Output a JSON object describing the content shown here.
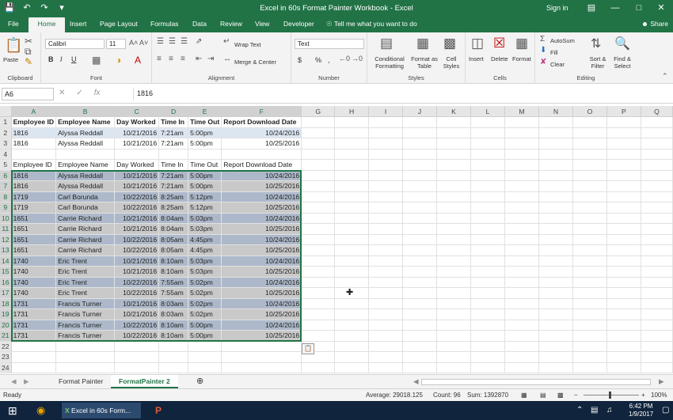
{
  "window": {
    "title": "Excel in 60s Format Painter Workbook  -  Excel",
    "signin": "Sign in"
  },
  "tabs": [
    "File",
    "Home",
    "Insert",
    "Page Layout",
    "Formulas",
    "Data",
    "Review",
    "View",
    "Developer"
  ],
  "tell_me": "Tell me what you want to do",
  "share": "Share",
  "ribbon": {
    "clipboard": {
      "paste": "Paste",
      "label": "Clipboard"
    },
    "font": {
      "name": "Calibri",
      "size": "11",
      "label": "Font",
      "bold": "B",
      "italic": "I",
      "underline": "U"
    },
    "alignment": {
      "wrap": "Wrap Text",
      "merge": "Merge & Center",
      "label": "Alignment"
    },
    "number": {
      "format": "Text",
      "label": "Number",
      "currency": "$",
      "percent": "%",
      "comma": ","
    },
    "styles": {
      "cond": "Conditional Formatting",
      "table": "Format as Table",
      "cell": "Cell Styles",
      "label": "Styles"
    },
    "cells": {
      "insert": "Insert",
      "delete": "Delete",
      "format": "Format",
      "label": "Cells"
    },
    "editing": {
      "autosum": "AutoSum",
      "fill": "Fill",
      "clear": "Clear",
      "sort": "Sort & Filter",
      "find": "Find & Select",
      "label": "Editing"
    }
  },
  "formula_bar": {
    "name_box": "A6",
    "formula": "1816",
    "fx": "fx"
  },
  "columns": [
    "A",
    "B",
    "C",
    "D",
    "E",
    "F",
    "G",
    "H",
    "I",
    "J",
    "K",
    "L",
    "M",
    "N",
    "O",
    "P",
    "Q"
  ],
  "headers": [
    "Employee ID",
    "Employee Name",
    "Day Worked",
    "Time In",
    "Time Out",
    "Report Download Date"
  ],
  "rows": [
    {
      "n": "1",
      "type": "header"
    },
    {
      "n": "2",
      "type": "blue",
      "cells": [
        "1816",
        "Alyssa Reddall",
        "10/21/2016",
        "7:21am",
        "5:00pm",
        "10/24/2016"
      ]
    },
    {
      "n": "3",
      "type": "plain",
      "cells": [
        "1816",
        "Alyssa Reddall",
        "10/21/2016",
        "7:21am",
        "5:00pm",
        "10/25/2016"
      ]
    },
    {
      "n": "4",
      "type": "empty"
    },
    {
      "n": "5",
      "type": "header2"
    },
    {
      "n": "6",
      "type": "slate",
      "cells": [
        "1816",
        "Alyssa Reddall",
        "10/21/2016",
        "7:21am",
        "5:00pm",
        "10/24/2016"
      ]
    },
    {
      "n": "7",
      "type": "gray",
      "cells": [
        "1816",
        "Alyssa Reddall",
        "10/21/2016",
        "7:21am",
        "5:00pm",
        "10/25/2016"
      ]
    },
    {
      "n": "8",
      "type": "slate",
      "cells": [
        "1719",
        "Carl Borunda",
        "10/22/2016",
        "8:25am",
        "5:12pm",
        "10/24/2016"
      ]
    },
    {
      "n": "9",
      "type": "gray",
      "cells": [
        "1719",
        "Carl Borunda",
        "10/22/2016",
        "8:25am",
        "5:12pm",
        "10/25/2016"
      ]
    },
    {
      "n": "10",
      "type": "slate",
      "cells": [
        "1651",
        "Carrie Richard",
        "10/21/2016",
        "8:04am",
        "5:03pm",
        "10/24/2016"
      ]
    },
    {
      "n": "11",
      "type": "gray",
      "cells": [
        "1651",
        "Carrie Richard",
        "10/21/2016",
        "8:04am",
        "5:03pm",
        "10/25/2016"
      ]
    },
    {
      "n": "12",
      "type": "slate",
      "cells": [
        "1651",
        "Carrie Richard",
        "10/22/2016",
        "8:05am",
        "4:45pm",
        "10/24/2016"
      ]
    },
    {
      "n": "13",
      "type": "gray",
      "cells": [
        "1651",
        "Carrie Richard",
        "10/22/2016",
        "8:05am",
        "4:45pm",
        "10/25/2016"
      ]
    },
    {
      "n": "14",
      "type": "slate",
      "cells": [
        "1740",
        "Eric Trent",
        "10/21/2016",
        "8:10am",
        "5:03pm",
        "10/24/2016"
      ]
    },
    {
      "n": "15",
      "type": "gray",
      "cells": [
        "1740",
        "Eric Trent",
        "10/21/2016",
        "8:10am",
        "5:03pm",
        "10/25/2016"
      ]
    },
    {
      "n": "16",
      "type": "slate",
      "cells": [
        "1740",
        "Eric Trent",
        "10/22/2016",
        "7:55am",
        "5:02pm",
        "10/24/2016"
      ]
    },
    {
      "n": "17",
      "type": "gray",
      "cells": [
        "1740",
        "Eric Trent",
        "10/22/2016",
        "7:55am",
        "5:02pm",
        "10/25/2016"
      ]
    },
    {
      "n": "18",
      "type": "slate",
      "cells": [
        "1731",
        "Francis Turner",
        "10/21/2016",
        "8:03am",
        "5:02pm",
        "10/24/2016"
      ]
    },
    {
      "n": "19",
      "type": "gray",
      "cells": [
        "1731",
        "Francis Turner",
        "10/21/2016",
        "8:03am",
        "5:02pm",
        "10/25/2016"
      ]
    },
    {
      "n": "20",
      "type": "slate",
      "cells": [
        "1731",
        "Francis Turner",
        "10/22/2016",
        "8:10am",
        "5:00pm",
        "10/24/2016"
      ]
    },
    {
      "n": "21",
      "type": "gray",
      "cells": [
        "1731",
        "Francis Turner",
        "10/22/2016",
        "8:10am",
        "5:00pm",
        "10/25/2016"
      ]
    },
    {
      "n": "22",
      "type": "empty"
    },
    {
      "n": "23",
      "type": "empty"
    },
    {
      "n": "24",
      "type": "empty"
    }
  ],
  "sheets": [
    "Format Painter",
    "FormatPainter 2"
  ],
  "status": {
    "ready": "Ready",
    "average": "Average: 29018.125",
    "count": "Count: 96",
    "sum": "Sum: 1392870",
    "zoom": "100%"
  },
  "taskbar": {
    "excel_item": "Excel in 60s Form...",
    "time": "6:42 PM",
    "date": "1/9/2017"
  },
  "colors": {
    "accent": "#217346",
    "row_blue": "#dce6f1",
    "row_gray": "#c9c9c9",
    "row_slate": "#adb9ca"
  }
}
